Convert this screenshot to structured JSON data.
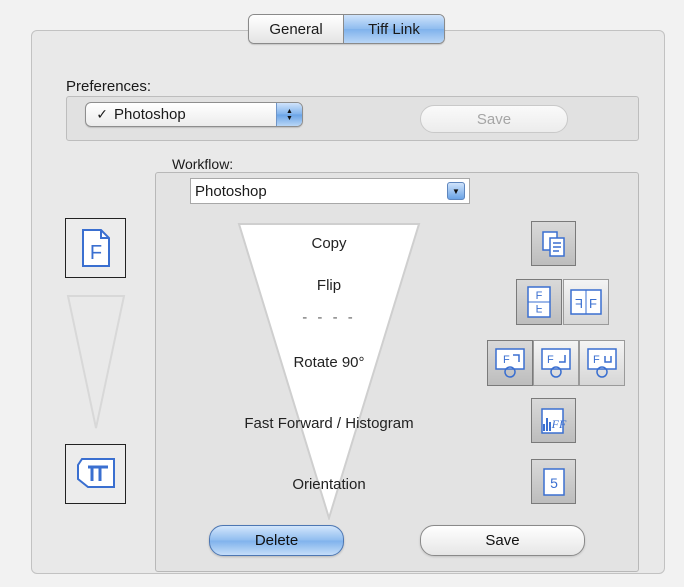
{
  "tabs": [
    {
      "label": "General",
      "selected": false
    },
    {
      "label": "Tiff Link",
      "selected": true
    }
  ],
  "preferences": {
    "label": "Preferences:",
    "selected": "Photoshop",
    "save_label": "Save"
  },
  "workflow": {
    "label": "Workflow:",
    "selected": "Photoshop",
    "steps": {
      "copy": "Copy",
      "flip": "Flip",
      "separator": "- - - -",
      "rotate": "Rotate 90°",
      "fast_forward": "Fast Forward / Histogram",
      "orientation": "Orientation"
    },
    "delete_label": "Delete",
    "save_label": "Save"
  },
  "colors": {
    "accent": "#7fb2ec",
    "icon_blue": "#3a6fd0"
  },
  "icons": [
    "source-f-icon",
    "oriented-output-icon",
    "copy-icon",
    "flip-vertical-icon",
    "flip-horizontal-icon",
    "rotate-left-icon",
    "rotate-right-icon",
    "rotate-180-icon",
    "fast-forward-histogram-icon",
    "orientation-icon"
  ]
}
